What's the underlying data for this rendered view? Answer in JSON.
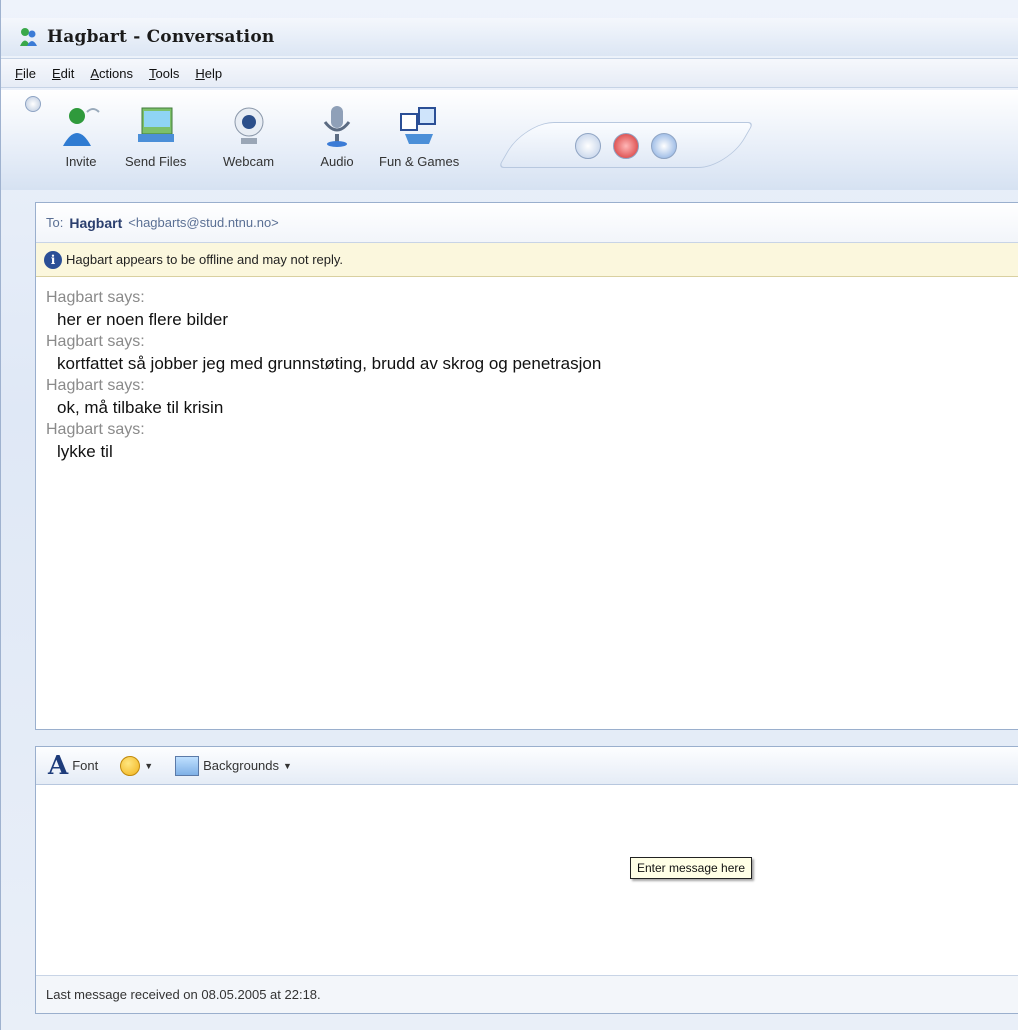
{
  "window": {
    "title": "Hagbart - Conversation"
  },
  "menu": {
    "items": [
      {
        "u": "F",
        "rest": "ile"
      },
      {
        "u": "E",
        "rest": "dit"
      },
      {
        "u": "A",
        "rest": "ctions"
      },
      {
        "u": "T",
        "rest": "ools"
      },
      {
        "u": "H",
        "rest": "elp"
      }
    ]
  },
  "toolbar": {
    "invite": "Invite",
    "send_files": "Send Files",
    "webcam": "Webcam",
    "audio": "Audio",
    "fun_games": "Fun & Games"
  },
  "conversation": {
    "to_label": "To:",
    "contact_name": "Hagbart",
    "contact_email": "<hagbarts@stud.ntnu.no>",
    "notice": "Hagbart appears to be offline and may not reply.",
    "messages": [
      {
        "sender": "Hagbart says:",
        "text": "her er noen flere bilder"
      },
      {
        "sender": "Hagbart says:",
        "text": "kortfattet så jobber jeg med grunnstøting, brudd av skrog og penetrasjon"
      },
      {
        "sender": "Hagbart says:",
        "text": "ok, må tilbake til krisin"
      },
      {
        "sender": "Hagbart says:",
        "text": "lykke til"
      }
    ]
  },
  "compose": {
    "font_label": "Font",
    "backgrounds_label": "Backgrounds",
    "tooltip": "Enter message here",
    "status": "Last message received on 08.05.2005 at 22:18."
  },
  "colors": {
    "accent": "#2b3f6e",
    "notice_bg": "#fbf7dd"
  }
}
